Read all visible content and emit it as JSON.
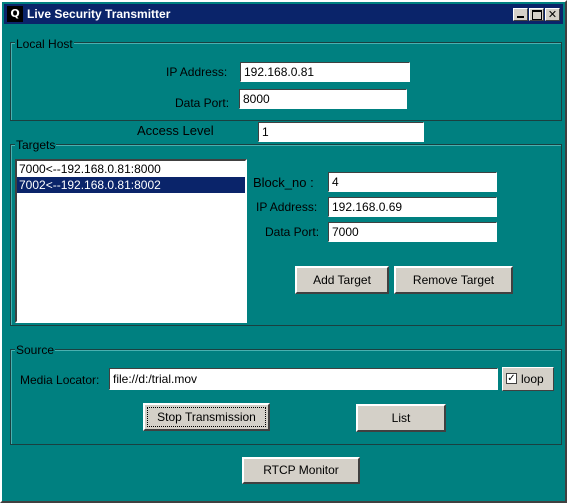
{
  "window": {
    "title": "Live Security Transmitter",
    "icon_letter": "Q",
    "close_glyph": "✕"
  },
  "local_host": {
    "legend": "Local Host",
    "ip_label": "IP Address:",
    "ip_value": "192.168.0.81",
    "port_label": "Data Port:",
    "port_value": "8000"
  },
  "access": {
    "label": "Access Level",
    "value": "1"
  },
  "targets": {
    "legend": "Targets",
    "items": [
      {
        "text": "7000<--192.168.0.81:8000",
        "selected": false
      },
      {
        "text": "7002<--192.168.0.81:8002",
        "selected": true
      }
    ],
    "block_label": "Block_no :",
    "block_value": "4",
    "ip_label": "IP Address:",
    "ip_value": "192.168.0.69",
    "port_label": "Data Port:",
    "port_value": "7000",
    "add_label": "Add Target",
    "remove_label": "Remove Target"
  },
  "source": {
    "legend": "Source",
    "locator_label": "Media Locator:",
    "locator_value": "file://d:/trial.mov",
    "loop_label": "loop",
    "loop_checked": true,
    "loop_glyph": "✓",
    "stop_label": "Stop Transmission",
    "list_label": "List"
  },
  "rtcp_label": "RTCP Monitor",
  "colors": {
    "background": "#008080",
    "titlebar": "#0a246a",
    "selection": "#0a246a"
  }
}
